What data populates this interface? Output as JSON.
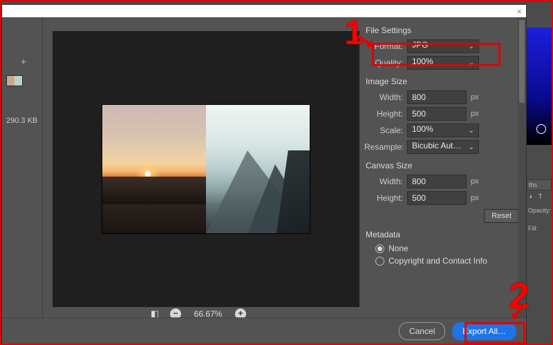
{
  "markers": {
    "one": "1",
    "two": "2"
  },
  "dialog": {
    "close_glyph": "×",
    "thumb": {
      "filesize": "290.3 KB",
      "add_glyph": "+"
    },
    "zoom": {
      "fit_glyph": "◧",
      "minus": "−",
      "percent": "66.67%",
      "plus": "+"
    },
    "settings": {
      "file_title": "File Settings",
      "format_label": "Format:",
      "format_value": "JPG",
      "quality_label": "Quality:",
      "quality_value": "100%",
      "image_title": "Image Size",
      "width_label": "Width:",
      "width_value": "800",
      "height_label": "Height:",
      "height_value": "500",
      "scale_label": "Scale:",
      "scale_value": "100%",
      "resample_label": "Resample:",
      "resample_value": "Bicubic Aut…",
      "canvas_title": "Canvas Size",
      "cwidth_value": "800",
      "cheight_value": "500",
      "px": "px",
      "reset": "Reset",
      "meta_title": "Metadata",
      "meta_none": "None",
      "meta_contact": "Copyright and Contact Info"
    },
    "footer": {
      "cancel": "Cancel",
      "export": "Export All…"
    }
  },
  "bg": {
    "tab1": "ths",
    "icons": "◑ T",
    "opacity": "Opacity:",
    "fill": "Fill:"
  }
}
